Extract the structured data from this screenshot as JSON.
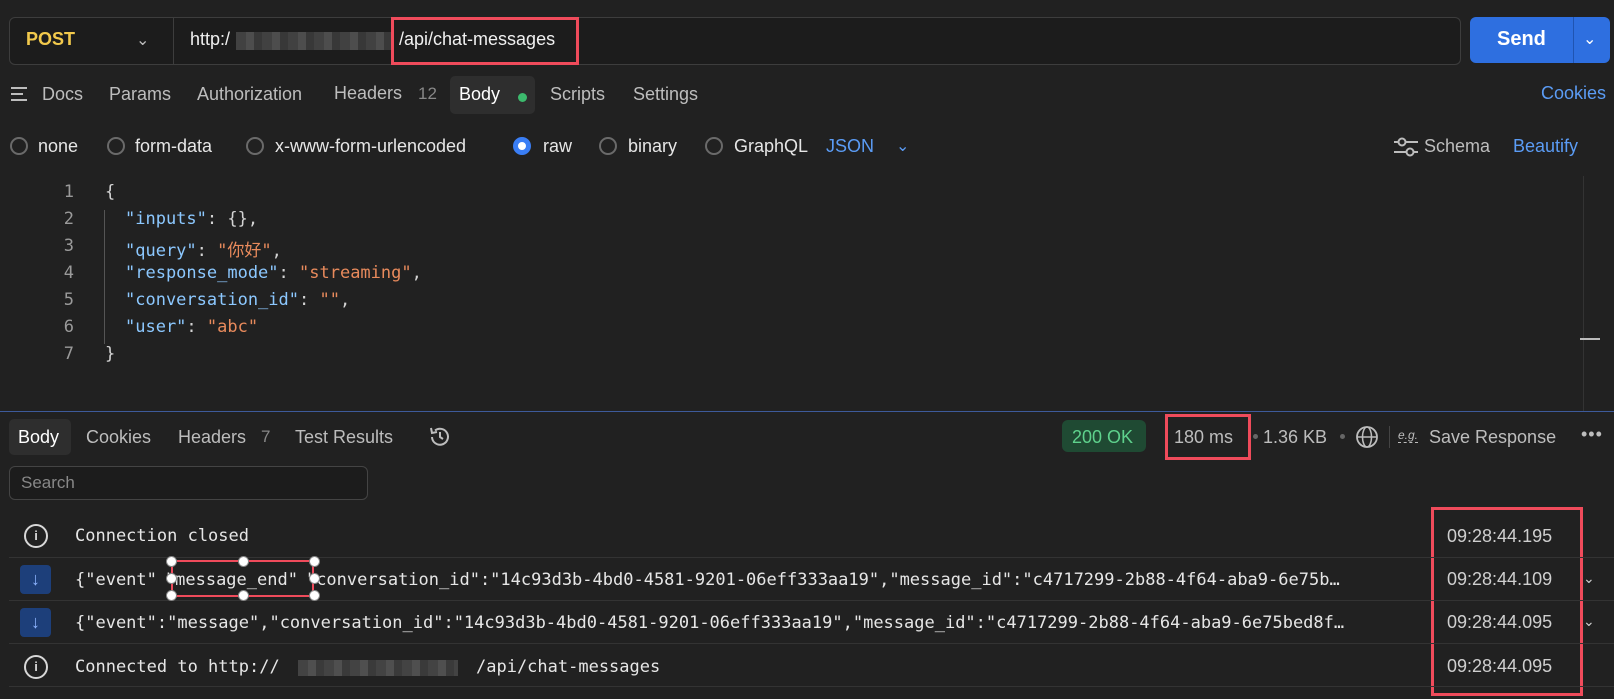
{
  "request": {
    "method": "POST",
    "url_prefix": "http:/",
    "url_path": "/api/chat-messages",
    "send_label": "Send"
  },
  "request_tabs": {
    "docs": "Docs",
    "params": "Params",
    "authorization": "Authorization",
    "headers": "Headers",
    "headers_count": "12",
    "body": "Body",
    "scripts": "Scripts",
    "settings": "Settings",
    "cookies": "Cookies"
  },
  "body_types": {
    "none": "none",
    "form_data": "form-data",
    "urlencoded": "x-www-form-urlencoded",
    "raw": "raw",
    "binary": "binary",
    "graphql": "GraphQL",
    "format": "JSON",
    "schema": "Schema",
    "beautify": "Beautify"
  },
  "editor": {
    "line_numbers": [
      "1",
      "2",
      "3",
      "4",
      "5",
      "6",
      "7"
    ],
    "open": "{",
    "close": "}",
    "fields": [
      {
        "key": "\"inputs\"",
        "value": "{}",
        "tail": ","
      },
      {
        "key": "\"query\"",
        "value": "\"你好\"",
        "tail": ","
      },
      {
        "key": "\"response_mode\"",
        "value": "\"streaming\"",
        "tail": ","
      },
      {
        "key": "\"conversation_id\"",
        "value": "\"\"",
        "tail": ","
      },
      {
        "key": "\"user\"",
        "value": "\"abc\"",
        "tail": ""
      }
    ]
  },
  "response_tabs": {
    "body": "Body",
    "cookies": "Cookies",
    "headers": "Headers",
    "headers_count": "7",
    "test_results": "Test Results"
  },
  "response_meta": {
    "status": "200 OK",
    "time": "180 ms",
    "size": "1.36 KB",
    "save_response": "Save Response"
  },
  "search": {
    "placeholder": "Search"
  },
  "events": [
    {
      "icon": "info-icon",
      "text": "Connection closed",
      "time": "09:28:44.195"
    },
    {
      "icon": "arrow-down-icon",
      "text_prefix": "{\"event\"",
      "text_highlight": "\"message_end\"",
      "text_suffix": "\"conversation_id\":\"14c93d3b-4bd0-4581-9201-06eff333aa19\",\"message_id\":\"c4717299-2b88-4f64-aba9-6e75b…",
      "time": "09:28:44.109"
    },
    {
      "icon": "arrow-down-icon",
      "text": "{\"event\":\"message\",\"conversation_id\":\"14c93d3b-4bd0-4581-9201-06eff333aa19\",\"message_id\":\"c4717299-2b88-4f64-aba9-6e75bed8f…",
      "time": "09:28:44.095"
    },
    {
      "icon": "info-icon",
      "text_prefix": "Connected to http://",
      "text_suffix": "/api/chat-messages",
      "time": "09:28:44.095"
    }
  ]
}
